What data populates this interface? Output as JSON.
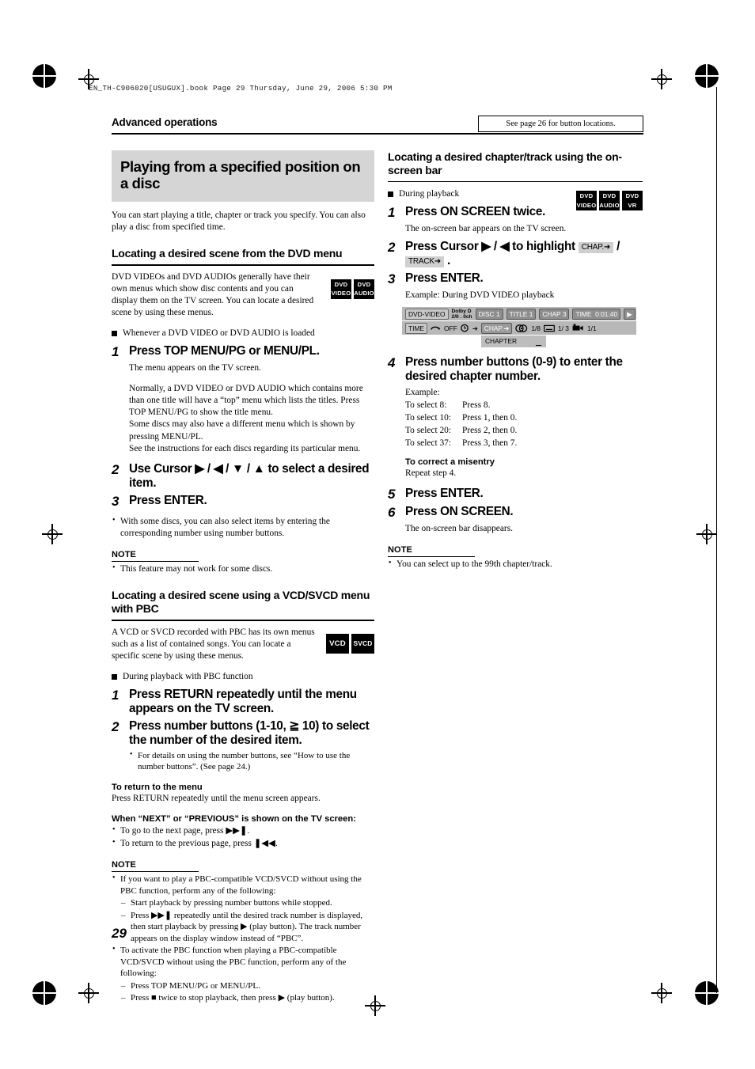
{
  "print_header": "EN_TH-C906020[USUGUX].book  Page 29  Thursday, June 29, 2006  5:30 PM",
  "running_head": "Advanced operations",
  "cross_ref_box": "See page 26 for button locations.",
  "page_number": "29",
  "left_column": {
    "banner_title": "Playing from a specified position on a disc",
    "intro": "You can start playing a title, chapter or track you specify. You can also play a disc from specified time.",
    "section1": {
      "heading": "Locating a desired scene from the DVD menu",
      "paragraph": "DVD VIDEOs and DVD AUDIOs generally have their own menus which show disc contents and you can display them on the TV screen. You can locate a desired scene by using these menus.",
      "badges": [
        {
          "line1": "DVD",
          "line2": "VIDEO"
        },
        {
          "line1": "DVD",
          "line2": "AUDIO"
        }
      ],
      "condition": "Whenever a DVD VIDEO or DVD AUDIO is loaded",
      "steps": [
        {
          "num": "1",
          "text": "Press TOP MENU/PG or MENU/PL.",
          "body": "The menu appears on the TV screen.",
          "body2": "Normally, a DVD VIDEO or DVD AUDIO which contains more than one title will have a “top” menu which lists the titles. Press TOP MENU/PG to show the title menu.\nSome discs may also have a different menu which is shown by pressing MENU/PL.\nSee the instructions for each discs regarding its particular menu."
        },
        {
          "num": "2",
          "text": "Use Cursor ▶ / ◀ / ▼ / ▲ to select a desired item."
        },
        {
          "num": "3",
          "text": "Press ENTER."
        }
      ],
      "bullet_after": "With some discs, you can also select items by entering the corresponding number using number buttons.",
      "note_label": "NOTE",
      "note_items": [
        "This feature may not work for some discs."
      ]
    },
    "section2": {
      "heading": "Locating a desired scene using a VCD/SVCD menu with PBC",
      "paragraph": "A VCD or SVCD recorded with PBC has its own menus such as a list of contained songs. You can locate a specific scene by using these menus.",
      "badges": [
        {
          "line1": "VCD"
        },
        {
          "line1": "SVCD"
        }
      ],
      "condition": "During playback with PBC function",
      "steps": [
        {
          "num": "1",
          "text": "Press RETURN repeatedly until the menu appears on the TV screen."
        },
        {
          "num": "2",
          "text": "Press number buttons (1-10, ≧ 10) to select the number of the desired item.",
          "bullet": "For details on using the number buttons, see “How to use the number buttons”. (See page 24.)"
        }
      ],
      "sub1_title": "To return to the menu",
      "sub1_text": "Press RETURN repeatedly until the menu screen appears.",
      "sub2_title": "When “NEXT” or “PREVIOUS” is shown on the TV screen:",
      "sub2_items": [
        "To go to the next page, press ▶▶❚.",
        "To return to the previous page, press ❚◀◀."
      ],
      "note_label": "NOTE",
      "note_items": [
        "If you want to play a PBC-compatible VCD/SVCD without using the PBC function, perform any of the following:",
        "To activate the PBC function when playing a PBC-compatible VCD/SVCD without using the PBC function, perform any of the following:"
      ],
      "note_sub1": [
        "Start playback by pressing number buttons while stopped.",
        "Press ▶▶❚ repeatedly until the desired track number is displayed, then start playback by pressing ▶ (play button). The track number appears on the display window instead of “PBC”."
      ],
      "note_sub2": [
        "Press TOP MENU/PG or MENU/PL.",
        "Press ■ twice to stop playback, then press ▶ (play button)."
      ]
    }
  },
  "right_column": {
    "heading": "Locating a desired chapter/track using the on-screen bar",
    "badges": [
      {
        "line1": "DVD",
        "line2": "VIDEO"
      },
      {
        "line1": "DVD",
        "line2": "AUDIO"
      },
      {
        "line1": "DVD",
        "line2": "VR"
      }
    ],
    "condition": "During playback",
    "steps": [
      {
        "num": "1",
        "text": "Press ON SCREEN twice.",
        "body": "The on-screen bar appears on the TV screen."
      },
      {
        "num": "2",
        "text_a": "Press Cursor ▶ / ◀ to highlight ",
        "tag1": "CHAP.➜",
        "sep": " / ",
        "tag2": "TRACK➜",
        "tail": " ."
      },
      {
        "num": "3",
        "text": "Press ENTER.",
        "body": "Example: During DVD VIDEO playback"
      },
      {
        "num": "4",
        "text": "Press number buttons (0-9) to enter the desired chapter number.",
        "example_label": "Example:",
        "examples": [
          {
            "c1": "To select 8:",
            "c2": "Press 8."
          },
          {
            "c1": "To select 10:",
            "c2": "Press 1, then 0."
          },
          {
            "c1": "To select 20:",
            "c2": "Press 2, then 0."
          },
          {
            "c1": "To select 37:",
            "c2": "Press 3, then 7."
          }
        ],
        "correct_title": "To correct a misentry",
        "correct_text": "Repeat step 4."
      },
      {
        "num": "5",
        "text": "Press ENTER."
      },
      {
        "num": "6",
        "text": "Press ON SCREEN.",
        "body": "The on-screen bar disappears."
      }
    ],
    "note_label": "NOTE",
    "note_items": [
      "You can select up to the 99th chapter/track."
    ],
    "onscreen_bar": {
      "row1": {
        "disc_type": "DVD-VIDEO",
        "audio_format_line1": "Dolby D",
        "audio_format_line2": "2/0 . 0ch",
        "disc": "DISC 1",
        "title": "TITLE 1",
        "chap": "CHAP  3",
        "time_label": "TIME",
        "time_value": "0:01:40",
        "arrow": "▶"
      },
      "row2": {
        "time": "TIME",
        "repeat": "OFF",
        "clock_arrow": "➜",
        "chap_highlight": "CHAP.➜",
        "audio": "1/8",
        "subtitle": "1/ 3",
        "angle": "1/1"
      },
      "row3_label": "CHAPTER"
    }
  }
}
